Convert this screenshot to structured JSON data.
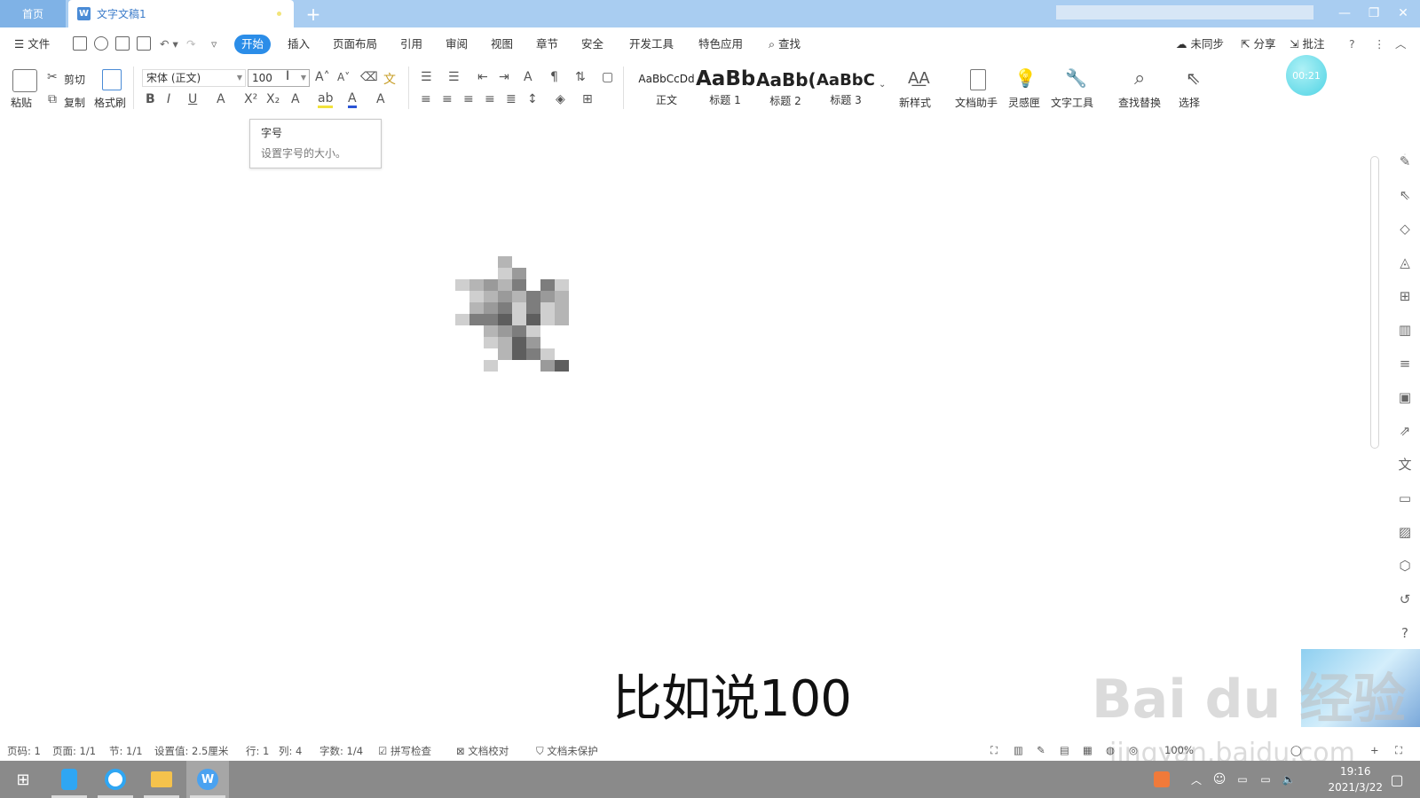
{
  "titlebar": {
    "home_tab": "首页",
    "doc_tab": "文字文稿1",
    "new_tab_icon": "plus-icon"
  },
  "menubar": {
    "file": "文件",
    "tabs": [
      "开始",
      "插入",
      "页面布局",
      "引用",
      "审阅",
      "视图",
      "章节",
      "安全",
      "开发工具",
      "特色应用"
    ],
    "search": "查找",
    "sync": "未同步",
    "share": "分享",
    "comment": "批注"
  },
  "ribbon": {
    "paste": "粘贴",
    "cut": "剪切",
    "copy": "复制",
    "format_painter": "格式刷",
    "font_name": "宋体 (正文)",
    "font_size": "100",
    "styles": [
      {
        "sample": "AaBbCcDd",
        "label": "正文"
      },
      {
        "sample": "AaBb",
        "label": "标题 1"
      },
      {
        "sample": "AaBb(",
        "label": "标题 2"
      },
      {
        "sample": "AaBbC(",
        "label": "标题 3"
      }
    ],
    "new_style": "新样式",
    "doc_assistant": "文档助手",
    "inspiration": "灵感匣",
    "text_tools": "文字工具",
    "find_replace": "查找替换",
    "select": "选择",
    "timer": "00:21"
  },
  "tooltip": {
    "title": "字号",
    "description": "设置字号的大小。"
  },
  "document": {
    "caption": "比如说100"
  },
  "watermark": {
    "brand": "Bai du 经验",
    "url": "jingyan.baidu.com"
  },
  "statusbar": {
    "page_number": "页码: 1",
    "pages": "页面: 1/1",
    "section": "节: 1/1",
    "setting": "设置值: 2.5厘米",
    "row": "行: 1",
    "col": "列: 4",
    "word_count": "字数: 1/4",
    "spell_check": "拼写检查",
    "doc_check": "文档校对",
    "protection": "文档未保护",
    "zoom": "100%"
  },
  "taskbar": {
    "time": "19:16",
    "date": "2021/3/22"
  },
  "colors": {
    "accent": "#2b8de8",
    "titlebar": "#a9cdf1",
    "taskbar": "#8a8a8a"
  }
}
